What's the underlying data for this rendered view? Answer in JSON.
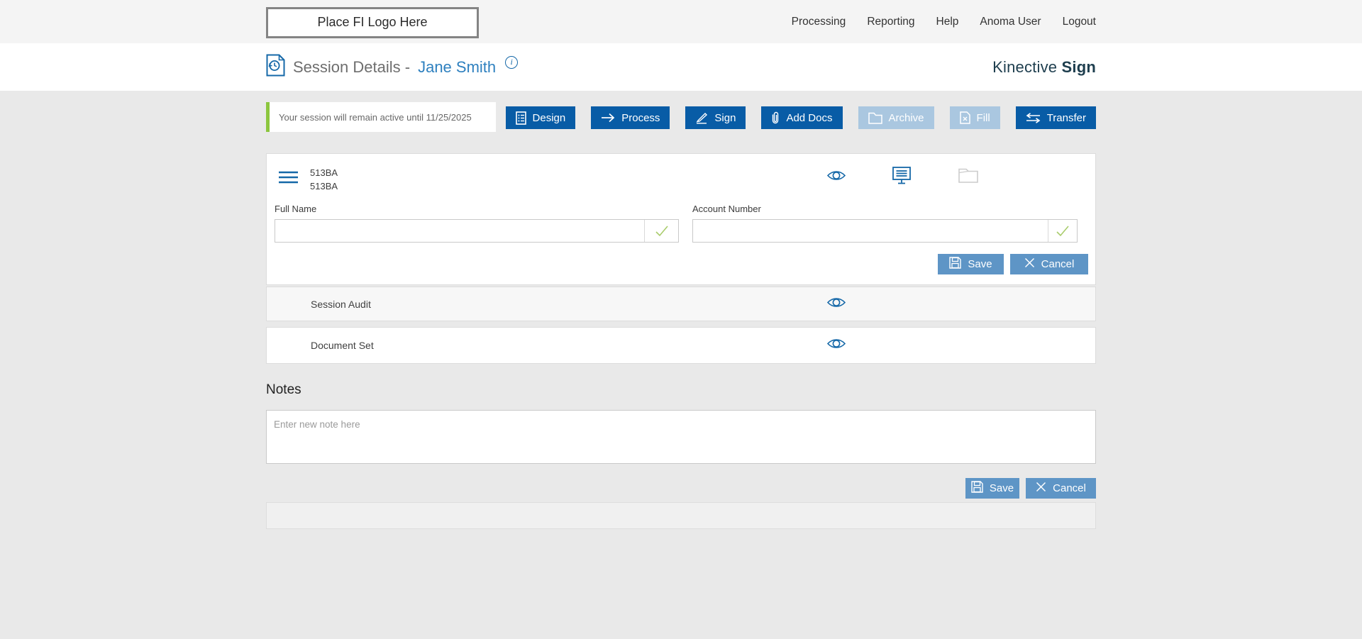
{
  "topbar": {
    "logo_text": "Place FI Logo Here",
    "nav": [
      {
        "label": "Processing"
      },
      {
        "label": "Reporting"
      },
      {
        "label": "Help"
      },
      {
        "label": "Anoma User"
      },
      {
        "label": "Logout"
      }
    ]
  },
  "header": {
    "title": "Session Details -",
    "session_name": "Jane Smith",
    "info_symbol": "i",
    "brand_regular": "Kinective",
    "brand_bold": "Sign"
  },
  "alert": {
    "message": "Your session will remain active until 11/25/2025"
  },
  "actions": [
    {
      "label": "Design",
      "enabled": true
    },
    {
      "label": "Process",
      "enabled": true
    },
    {
      "label": "Sign",
      "enabled": true
    },
    {
      "label": "Add Docs",
      "enabled": true
    },
    {
      "label": "Archive",
      "enabled": false
    },
    {
      "label": "Fill",
      "enabled": false
    },
    {
      "label": "Transfer",
      "enabled": true
    }
  ],
  "session_panel": {
    "id_line1": "513BA",
    "id_line2": "513BA",
    "fields": [
      {
        "label": "Full Name",
        "value": ""
      },
      {
        "label": "Account Number",
        "value": ""
      }
    ],
    "save_label": "Save",
    "cancel_label": "Cancel"
  },
  "rows": [
    {
      "label": "Session Audit"
    },
    {
      "label": "Document Set"
    }
  ],
  "notes": {
    "heading": "Notes",
    "placeholder": "Enter new note here",
    "save_label": "Save",
    "cancel_label": "Cancel"
  },
  "colors": {
    "primary_button": "#085ca6",
    "disabled_button": "#aac7e0",
    "secondary_button": "#5e95c6",
    "accent_green": "#8cc63e",
    "check_green": "#a9cc6b",
    "icon_blue": "#1568a8",
    "link_blue": "#2e80bf",
    "brand_dark": "#1e3e4e",
    "topbar_bg": "#f4f4f4",
    "page_bg": "#e9e9e9"
  }
}
